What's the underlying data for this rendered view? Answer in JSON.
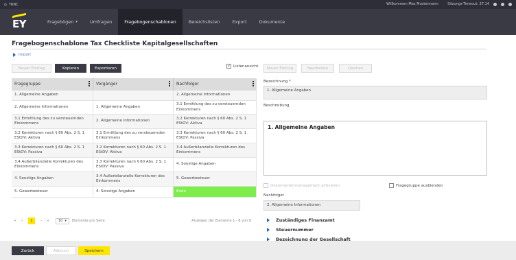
{
  "topbar": {
    "home_label": "TRNC",
    "welcome": "Willkommen Max Mustermann",
    "timeout_label": "Sitzungs-Timeout: 27:14"
  },
  "nav": {
    "logo": "EY",
    "items": [
      {
        "label": "Fragebögen",
        "has_dropdown": true
      },
      {
        "label": "Umfragen"
      },
      {
        "label": "Fragebogenschablonen",
        "active": true
      },
      {
        "label": "Bereichslisten"
      },
      {
        "label": "Export"
      },
      {
        "label": "Dokumente"
      }
    ]
  },
  "page": {
    "title": "Fragebogenschablone Tax Checkliste Kapitalgesellschaften",
    "import_link": "Import"
  },
  "toolbar": {
    "btn_disabled": "Neuer Eintrag",
    "btn_copy": "Kopieren",
    "btn_export": "Exportieren",
    "listview_label": "Listenansicht",
    "listview_checked": true
  },
  "right_toolbar": {
    "btn1": "Neuer Eintrag",
    "btn2": "Bearbeiten",
    "btn3": "Löschen"
  },
  "table": {
    "columns": [
      "Fragegruppe",
      "Vorgänger",
      "Nachfolger"
    ],
    "rows": [
      [
        "1. Allgemeine Angaben",
        "",
        "2. Allgemeine Informationen"
      ],
      [
        "2. Allgemeine Informationen",
        "1. Allgemeine Angaben",
        "3.1 Ermittlung des zu versteuernden Einkommens"
      ],
      [
        "3.1 Ermittlung des zu versteuernden Einkommens",
        "2. Allgemeine Informationen",
        "3.2 Korrekturen nach § 60 Abs. 2 S. 1 EStDV: Aktiva"
      ],
      [
        "3.2 Korrekturen nach § 60 Abs. 2 S. 1 EStDV: Aktiva",
        "3.1 Ermittlung des zu versteuernden Einkommens",
        "3.3 Korrekturen nach § 60 Abs. 2 S. 1 EStDV: Passiva"
      ],
      [
        "3.3 Korrekturen nach § 60 Abs. 2 S. 1 EStDV: Passiva",
        "3.2 Korrekturen nach § 60 Abs. 2 S. 1 EStDV: Aktiva",
        "3.4 Außerbilanzielle Korrekturen des Einkommens"
      ],
      [
        "3.4 Außerbilanzielle Korrekturen des Einkommens",
        "3.3 Korrekturen nach § 60 Abs. 2 S. 1 EStDV: Passiva",
        "4. Sonstige Angaben"
      ],
      [
        "4. Sonstige Angaben",
        "3.4 Außerbilanzielle Korrekturen des Einkommens",
        "5. Gewerbesteuer"
      ],
      [
        "5. Gewerbesteuer",
        "4. Sonstige Angaben",
        "Ende"
      ]
    ]
  },
  "pager": {
    "first": "«",
    "prev": "‹",
    "current_page": "1",
    "next": "›",
    "last": "»",
    "page_size": "10",
    "page_size_label": "Elemente pro Seite",
    "summary": "Anzeigen der Elemente 1 - 8 von 8"
  },
  "detail": {
    "name_label": "Bezeichnung *",
    "name_value": "1. Allgemeine Angaben",
    "desc_label": "Beschreibung",
    "desc_heading": "1. Allgemeine Angaben",
    "docmgmt_label": "Dokumentenmanagement aktivieren",
    "hide_group_label": "Fragegruppe ausblenden",
    "successor_label": "Nachfolger",
    "successor_value": "2. Allgemeine Informationen",
    "sections": [
      "Zuständiges Finanzamt",
      "Steuernummer",
      "Bezeichnung der Gesellschaft"
    ]
  },
  "footer": {
    "back": "Zurück",
    "disabled": "Abbruch",
    "save": "Speichern"
  },
  "colors": {
    "accent_yellow": "#ffe600",
    "nav_dark": "#3a3a45",
    "end_green": "#7ded4a"
  }
}
